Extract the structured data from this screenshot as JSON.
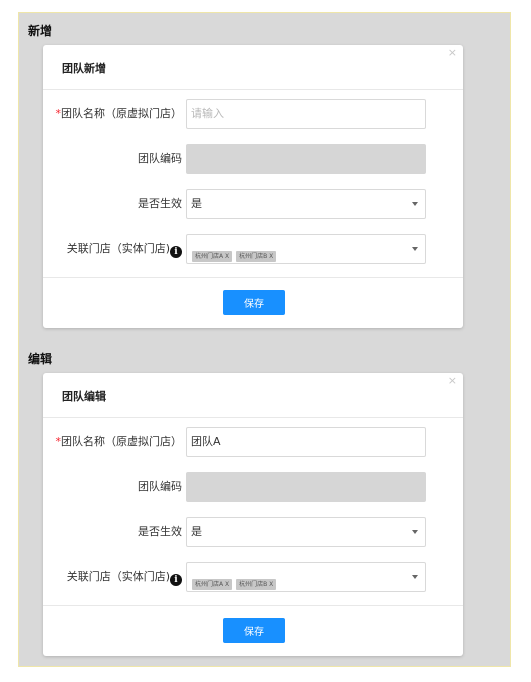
{
  "sections": {
    "add": {
      "heading": "新增",
      "modal_title": "团队新增",
      "close_glyph": "×",
      "fields": {
        "team_name": {
          "label": "团队名称（原虚拟门店）",
          "placeholder": "请输入",
          "value": ""
        },
        "team_code": {
          "label": "团队编码",
          "value": ""
        },
        "is_active": {
          "label": "是否生效",
          "value": "是"
        },
        "linked_stores": {
          "label": "关联门店（实体门店)",
          "tags": [
            "杭州门店A X",
            "杭州门店B X"
          ]
        }
      },
      "save_label": "保存"
    },
    "edit": {
      "heading": "编辑",
      "modal_title": "团队编辑",
      "close_glyph": "×",
      "fields": {
        "team_name": {
          "label": "团队名称（原虚拟门店）",
          "placeholder": "",
          "value": "团队A"
        },
        "team_code": {
          "label": "团队编码",
          "value": ""
        },
        "is_active": {
          "label": "是否生效",
          "value": "是"
        },
        "linked_stores": {
          "label": "关联门店（实体门店)",
          "tags": [
            "杭州门店A X",
            "杭州门店B X"
          ]
        }
      },
      "save_label": "保存"
    }
  },
  "icons": {
    "info": "info-circle-icon",
    "dropdown": "chevron-down-icon",
    "close": "close-icon"
  },
  "colors": {
    "primary": "#1890ff",
    "required": "#f5222d",
    "page_bg": "#d9d9d9",
    "disabled_bg": "#d6d6d6"
  },
  "symbols": {
    "required_mark": "*",
    "info_glyph": "i"
  }
}
